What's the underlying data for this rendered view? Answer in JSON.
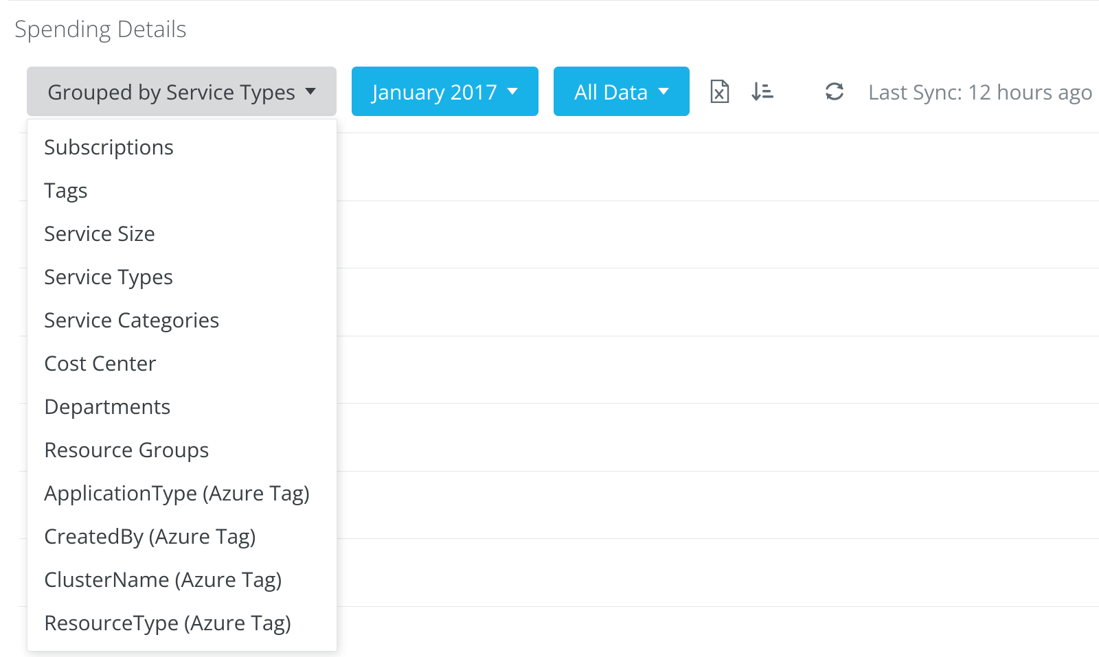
{
  "title": "Spending Details",
  "toolbar": {
    "group_by_label": "Grouped by Service Types",
    "date_label": "January 2017",
    "filter_label": "All Data",
    "sync_label": "Last Sync: 12 hours ago"
  },
  "group_by_menu": {
    "items": [
      "Subscriptions",
      "Tags",
      "Service Size",
      "Service Types",
      "Service Categories",
      "Cost Center",
      "Departments",
      "Resource Groups",
      "ApplicationType (Azure Tag)",
      "CreatedBy (Azure Tag)",
      "ClusterName (Azure Tag)",
      "ResourceType (Azure Tag)"
    ]
  },
  "colors": {
    "accent": "#19b2e8",
    "button_grey": "#d8d9db",
    "icon_grey": "#5f6a72",
    "text_muted": "#7f878d",
    "divider": "#e4e7e9"
  }
}
